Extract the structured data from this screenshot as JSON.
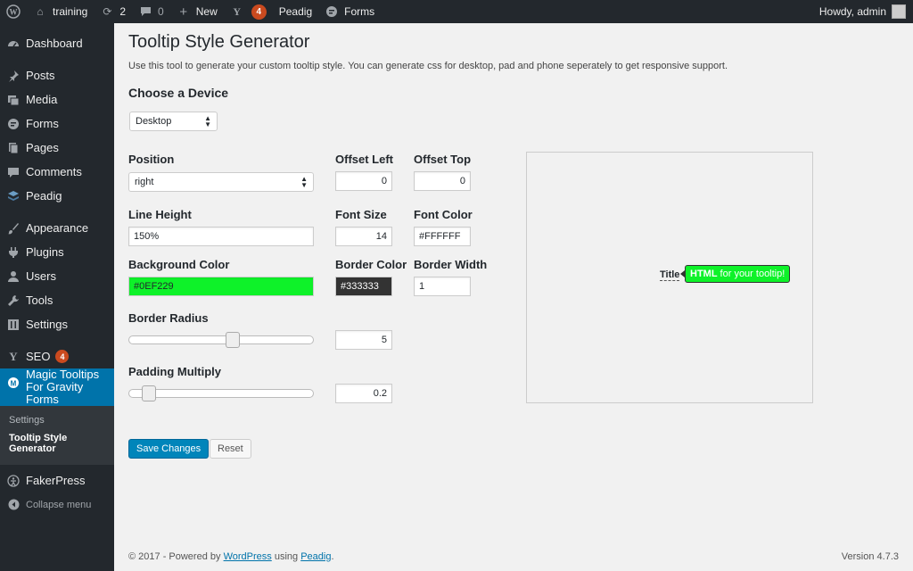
{
  "adminbar": {
    "site_name": "training",
    "updates_count": "2",
    "comments_count": "0",
    "new_label": "New",
    "yoast_badge": "4",
    "peadig_label": "Peadig",
    "forms_label": "Forms",
    "greeting": "Howdy, admin"
  },
  "sidebar": {
    "items": [
      {
        "label": "Dashboard"
      },
      {
        "label": "Posts"
      },
      {
        "label": "Media"
      },
      {
        "label": "Forms"
      },
      {
        "label": "Pages"
      },
      {
        "label": "Comments"
      },
      {
        "label": "Peadig"
      },
      {
        "label": "Appearance"
      },
      {
        "label": "Plugins"
      },
      {
        "label": "Users"
      },
      {
        "label": "Tools"
      },
      {
        "label": "Settings"
      },
      {
        "label": "SEO",
        "badge": "4"
      },
      {
        "label": "Magic Tooltips For Gravity Forms"
      },
      {
        "label": "FakerPress"
      },
      {
        "label": "Collapse menu"
      }
    ],
    "submenu": [
      {
        "label": "Settings"
      },
      {
        "label": "Tooltip Style Generator"
      }
    ]
  },
  "page": {
    "title": "Tooltip Style Generator",
    "description": "Use this tool to generate your custom tooltip style. You can generate css for desktop, pad and phone seperately to get responsive support.",
    "device_heading": "Choose a Device",
    "device_value": "Desktop"
  },
  "form": {
    "position_label": "Position",
    "position_value": "right",
    "offset_left_label": "Offset Left",
    "offset_left_value": "0",
    "offset_top_label": "Offset Top",
    "offset_top_value": "0",
    "line_height_label": "Line Height",
    "line_height_value": "150%",
    "font_size_label": "Font Size",
    "font_size_value": "14",
    "font_color_label": "Font Color",
    "font_color_value": "#FFFFFF",
    "bg_color_label": "Background Color",
    "bg_color_value": "#0EF229",
    "border_color_label": "Border Color",
    "border_color_value": "#333333",
    "border_width_label": "Border Width",
    "border_width_value": "1",
    "border_radius_label": "Border Radius",
    "border_radius_value": "5",
    "padding_label": "Padding Multiply",
    "padding_value": "0.2"
  },
  "preview": {
    "title_text": "Title",
    "tooltip_bold": "HTML",
    "tooltip_rest": "for your tooltip!"
  },
  "buttons": {
    "save": "Save Changes",
    "reset": "Reset"
  },
  "footer": {
    "prefix": "© 2017 - Powered by ",
    "wordpress": "WordPress",
    "using": " using ",
    "peadig": "Peadig",
    "suffix": ".",
    "version": "Version 4.7.3"
  },
  "colors": {
    "accent": "#0073aa",
    "primary_button": "#0085ba",
    "tooltip_bg": "#0EF229",
    "tooltip_border": "#333333",
    "badge": "#ca4a1f"
  }
}
